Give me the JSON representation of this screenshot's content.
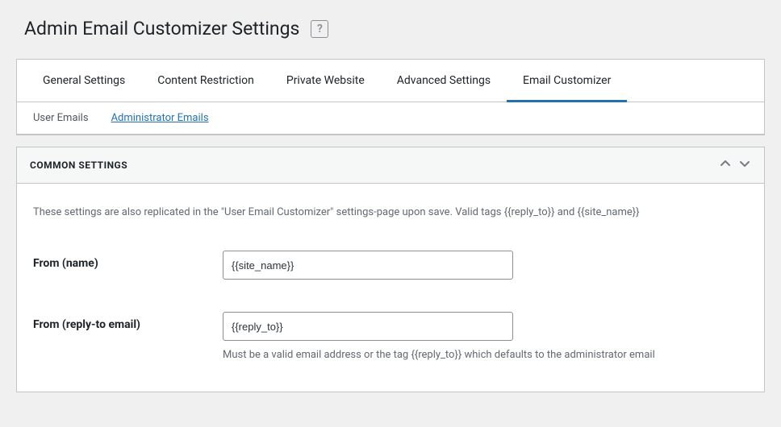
{
  "header": {
    "title": "Admin Email Customizer Settings"
  },
  "tabs_primary": [
    {
      "label": "General Settings"
    },
    {
      "label": "Content Restriction"
    },
    {
      "label": "Private Website"
    },
    {
      "label": "Advanced Settings"
    },
    {
      "label": "Email Customizer"
    }
  ],
  "tabs_secondary": [
    {
      "label": "User Emails"
    },
    {
      "label": "Administrator Emails"
    }
  ],
  "section": {
    "title": "COMMON SETTINGS",
    "description": "These settings are also replicated in the \"User Email Customizer\" settings-page upon save. Valid tags {{reply_to}} and {{site_name}}"
  },
  "fields": {
    "from_name": {
      "label": "From (name)",
      "value": "{{site_name}}"
    },
    "from_reply": {
      "label": "From (reply-to email)",
      "value": "{{reply_to}}",
      "help": "Must be a valid email address or the tag {{reply_to}} which defaults to the administrator email"
    }
  }
}
